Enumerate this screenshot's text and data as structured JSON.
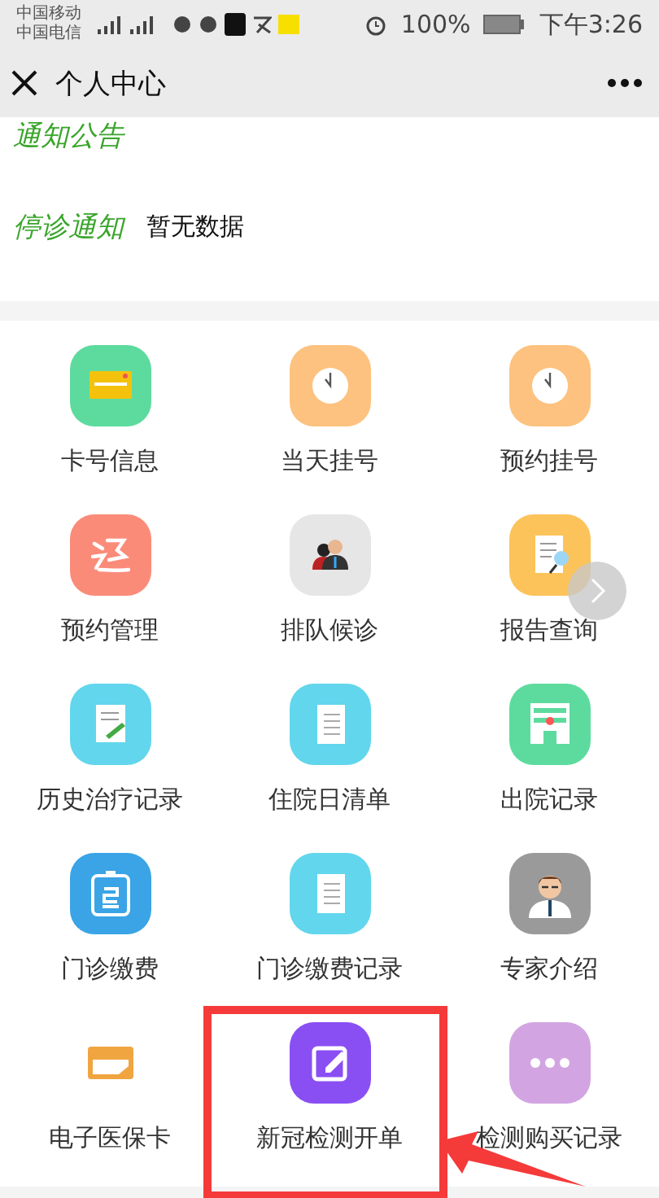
{
  "status_bar": {
    "carriers": [
      "中国移动",
      "中国电信"
    ],
    "battery": "100%",
    "time": "下午3:26"
  },
  "header": {
    "title": "个人中心"
  },
  "notices": [
    {
      "label": "通知公告"
    },
    {
      "label": "停诊通知",
      "text": "暂无数据"
    }
  ],
  "grid": [
    {
      "label": "卡号信息",
      "kind": "card",
      "color": "#5ddb9e",
      "highlighted": false
    },
    {
      "label": "当天挂号",
      "kind": "clock",
      "color": "#fdc27f",
      "highlighted": false
    },
    {
      "label": "预约挂号",
      "kind": "clock",
      "color": "#fdc27f",
      "highlighted": false
    },
    {
      "label": "预约管理",
      "kind": "refund",
      "color": "#fb8b79",
      "highlighted": false
    },
    {
      "label": "排队候诊",
      "kind": "people",
      "color": "#e6e6e6",
      "highlighted": false
    },
    {
      "label": "报告查询",
      "kind": "report",
      "color": "#fcc35a",
      "highlighted": false
    },
    {
      "label": "历史治疗记录",
      "kind": "note",
      "color": "#62d6ec",
      "highlighted": false
    },
    {
      "label": "住院日清单",
      "kind": "list",
      "color": "#62d6ec",
      "highlighted": false
    },
    {
      "label": "出院记录",
      "kind": "hospital",
      "color": "#5ddb9e",
      "highlighted": false
    },
    {
      "label": "门诊缴费",
      "kind": "bill",
      "color": "#3aa4e6",
      "highlighted": false
    },
    {
      "label": "门诊缴费记录",
      "kind": "list",
      "color": "#62d6ec",
      "highlighted": false
    },
    {
      "label": "专家介绍",
      "kind": "doctor",
      "color": "#9a9a9a",
      "highlighted": false
    },
    {
      "label": "电子医保卡",
      "kind": "cardline",
      "color": "#f0a540",
      "highlighted": false
    },
    {
      "label": "新冠检测开单",
      "kind": "edit",
      "color": "#8a4ff2",
      "highlighted": true
    },
    {
      "label": "检测购买记录",
      "kind": "more",
      "color": "#d2a5e2",
      "highlighted": false
    }
  ]
}
